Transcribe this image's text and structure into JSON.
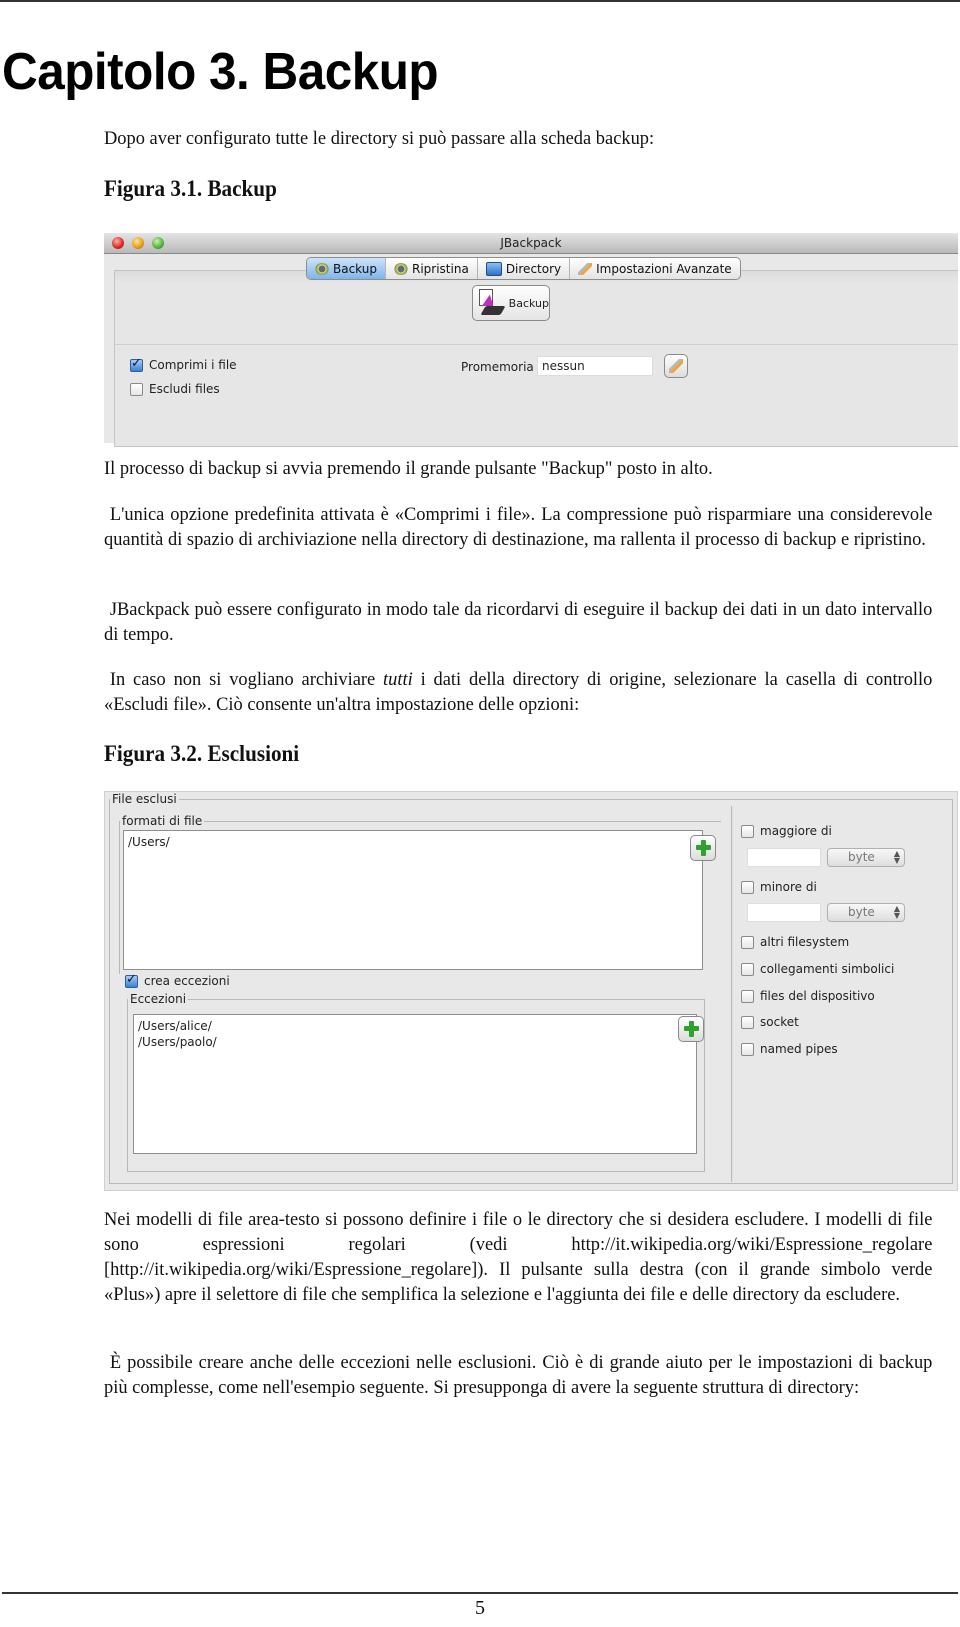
{
  "chapter": {
    "title": "Capitolo 3. Backup"
  },
  "intro": "Dopo aver configurato tutte le directory si può passare alla scheda backup:",
  "figure1": {
    "caption": "Figura 3.1. Backup",
    "window_title": "JBackpack",
    "tabs": [
      {
        "label": "Backup",
        "icon": "gear-icon",
        "active": true
      },
      {
        "label": "Ripristina",
        "icon": "gear-icon",
        "active": false
      },
      {
        "label": "Directory",
        "icon": "folder-icon",
        "active": false
      },
      {
        "label": "Impostazioni Avanzate",
        "icon": "wrench-icon",
        "active": false
      }
    ],
    "backup_button": "Backup",
    "checkboxes": [
      {
        "label": "Comprimi i file",
        "checked": true
      },
      {
        "label": "Escludi files",
        "checked": false
      }
    ],
    "reminder_label": "Promemoria",
    "reminder_value": "nessun"
  },
  "paragraphs1": [
    "Il processo di backup si avvia premendo il grande pulsante \"Backup\" posto in alto.",
    "L'unica opzione predefinita attivata è «Comprimi i file». La compressione può risparmiare una considerevole quantità di spazio di archiviazione nella directory di destinazione, ma rallenta il processo di backup e ripristino.",
    "JBackpack può essere configurato in modo tale da ricordarvi di eseguire il backup dei dati in un dato intervallo di tempo."
  ],
  "paragraph4": {
    "before": "In caso non si vogliano archiviare ",
    "emphasis": "tutti",
    "after": " i dati della directory di origine, selezionare la casella di controllo «Escludi file». Ciò consente un'altra impostazione delle opzioni:"
  },
  "figure2": {
    "caption": "Figura 3.2. Esclusioni",
    "group_title": "File esclusi",
    "formats_title": "formati di file",
    "formats_text": "/Users/",
    "exceptions_checkbox": {
      "label": "crea eccezioni",
      "checked": true
    },
    "exceptions_title": "Eccezioni",
    "exceptions_text": "/Users/alice/\n/Users/paolo/",
    "greater_than": {
      "label": "maggiore di",
      "checked": false,
      "value": "",
      "unit": "byte"
    },
    "less_than": {
      "label": "minore di",
      "checked": false,
      "value": "",
      "unit": "byte"
    },
    "options": [
      {
        "label": "altri filesystem",
        "checked": false
      },
      {
        "label": "collegamenti simbolici",
        "checked": false
      },
      {
        "label": "files del dispositivo",
        "checked": false
      },
      {
        "label": "socket",
        "checked": false
      },
      {
        "label": "named pipes",
        "checked": false
      }
    ]
  },
  "paragraphs2": [
    "Nei modelli di file area-testo si possono definire i file o le directory che si desidera escludere. I modelli di file sono espressioni regolari (vedi http://it.wikipedia.org/wiki/Espressione_regolare [http://it.wikipedia.org/wiki/Espressione_regolare]). Il pulsante sulla destra (con il grande simbolo verde «Plus») apre il selettore di file che semplifica la selezione e l'aggiunta dei file e delle directory da escludere.",
    "È possibile creare anche delle eccezioni nelle esclusioni. Ciò è di grande aiuto per le impostazioni di backup più complesse, come nell'esempio seguente. Si presupponga di avere la seguente struttura di directory:"
  ],
  "footer": {
    "page_number": "5"
  }
}
